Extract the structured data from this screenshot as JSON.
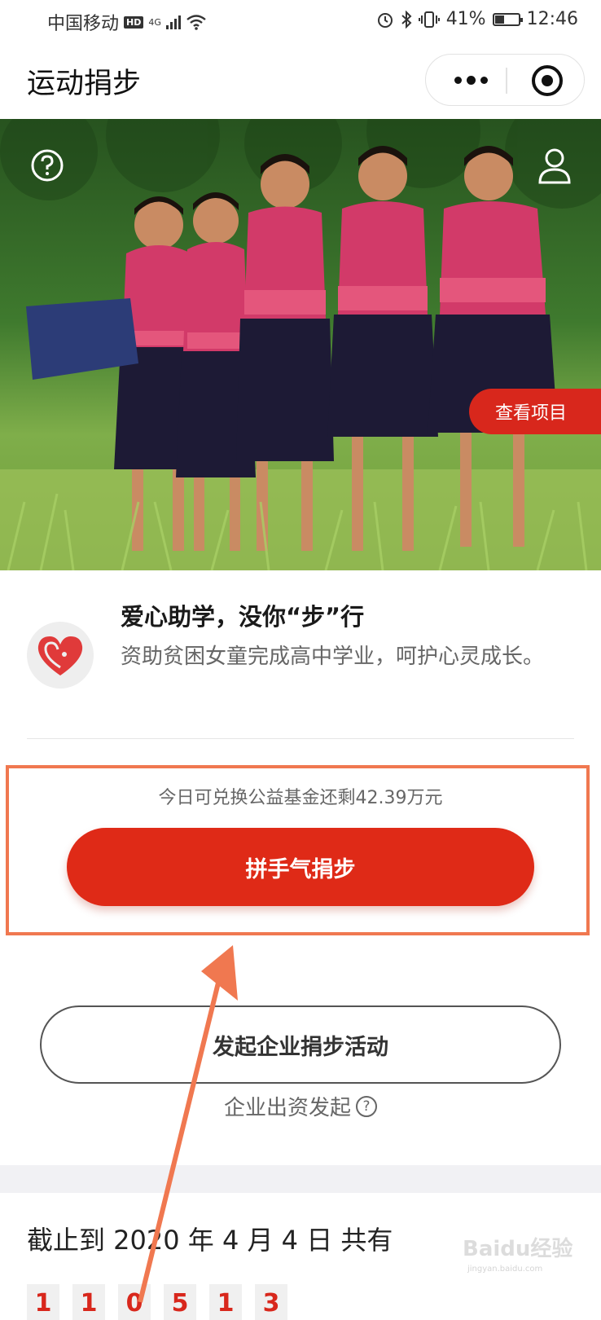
{
  "status_bar": {
    "carrier": "中国移动",
    "hd": "HD",
    "network": "4G",
    "battery": "41%",
    "battery_level": 0.41,
    "time": "12:46"
  },
  "navbar": {
    "title": "运动捐步"
  },
  "hero": {
    "view_project_label": "查看项目"
  },
  "project": {
    "title": "爱心助学，没你“步”行",
    "description": "资助贫困女童完成高中学业，呵护心灵成长。"
  },
  "donate": {
    "remaining_text": "今日可兑换公益基金还剩42.39万元",
    "button_label": "拼手气捐步"
  },
  "corporate": {
    "button_label": "发起企业捐步活动",
    "sub_label": "企业出资发起",
    "help_glyph": "?"
  },
  "stats": {
    "summary": "截止到 2020 年 4 月 4 日 共有",
    "digits": [
      "1",
      "1",
      "0",
      "5",
      "1",
      "3"
    ]
  },
  "watermark": {
    "brand": "Baidu经验",
    "url": "jingyan.baidu.com"
  },
  "colors": {
    "accent_red": "#df2a17",
    "highlight_orange": "#f07850"
  },
  "icons": {
    "help": "help-circle-icon",
    "user": "user-icon",
    "more": "more-dots-icon",
    "close": "target-close-icon",
    "logo": "heart-logo-icon"
  }
}
